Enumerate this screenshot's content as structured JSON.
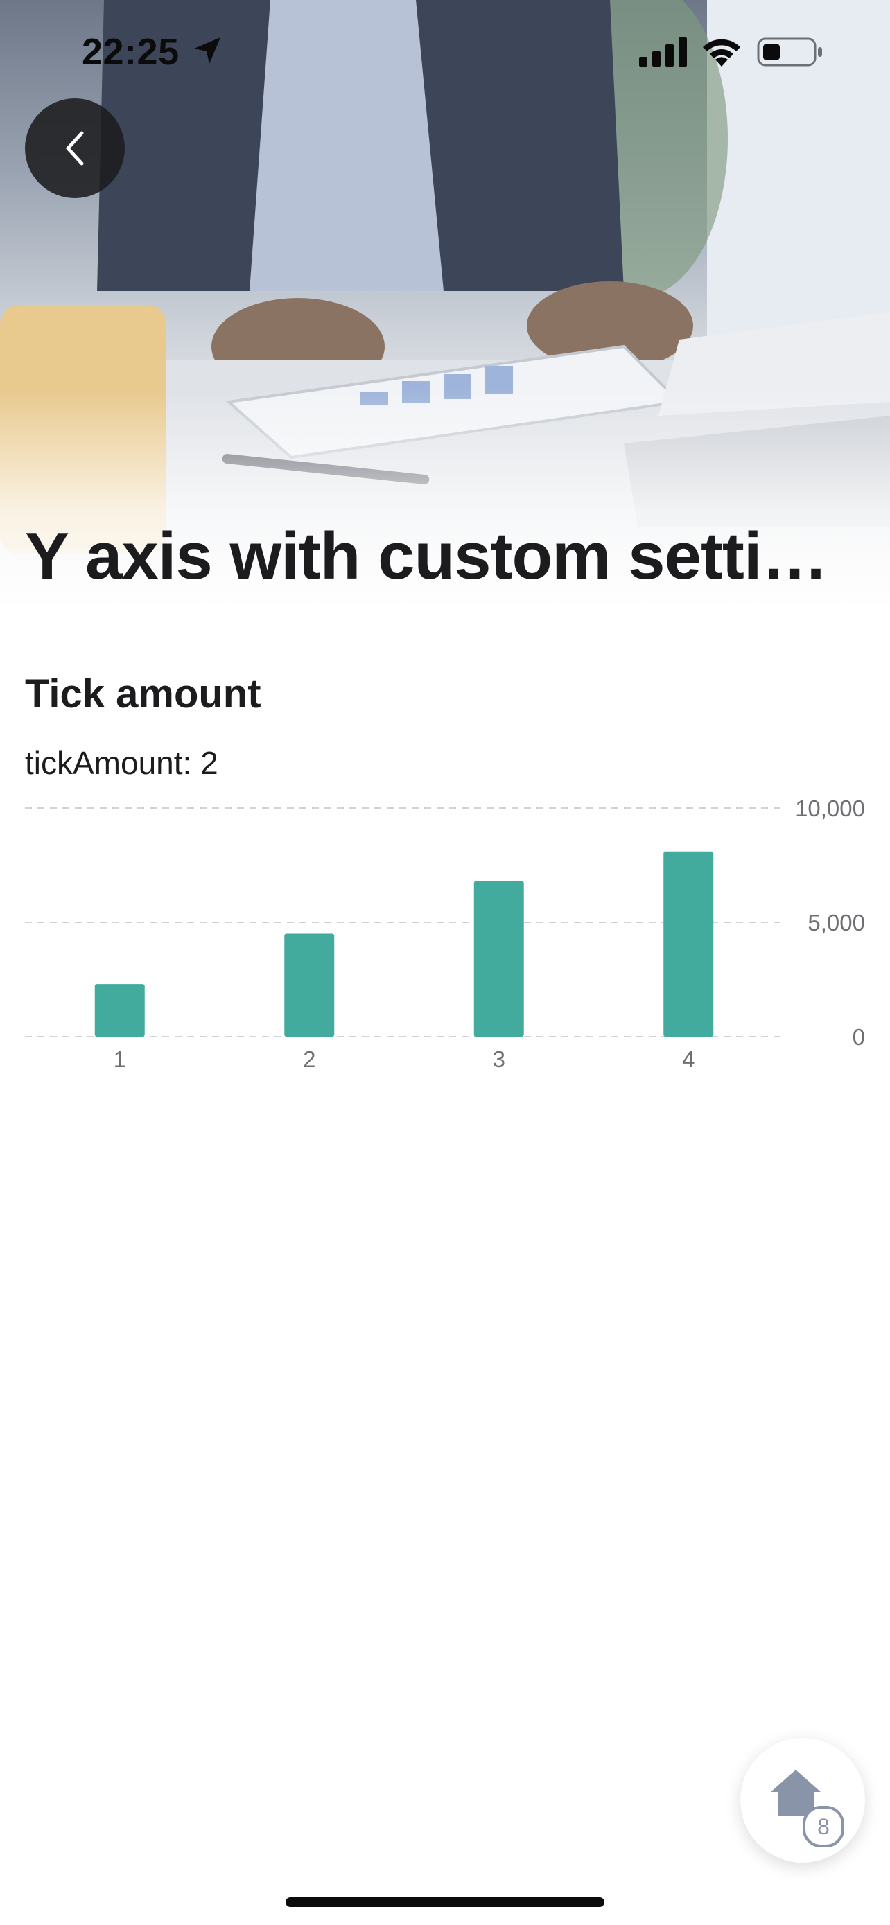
{
  "status_bar": {
    "time": "22:25",
    "icons": [
      "location-arrow-icon",
      "cellular-signal-icon",
      "wifi-icon",
      "battery-icon"
    ]
  },
  "header": {
    "title": "Y axis with custom setti…",
    "back_icon": "chevron-left-icon"
  },
  "section": {
    "title": "Tick amount",
    "subtitle": "tickAmount: 2"
  },
  "chart_data": {
    "type": "bar",
    "categories": [
      "1",
      "2",
      "3",
      "4"
    ],
    "values": [
      2300,
      4500,
      6800,
      8100
    ],
    "ylim": [
      0,
      10000
    ],
    "yticks": [
      0,
      5000,
      10000
    ],
    "ytick_labels": [
      "0",
      "5,000",
      "10,000"
    ],
    "y_axis_side": "right",
    "grid": true,
    "bar_color": "#43aa9e"
  },
  "fab": {
    "icon": "home-icon",
    "badge": "8"
  },
  "colors": {
    "accent": "#43aa9e",
    "text": "#1c1c1e",
    "grid": "#d2d2d6",
    "fab_icon": "#8a94a8"
  }
}
